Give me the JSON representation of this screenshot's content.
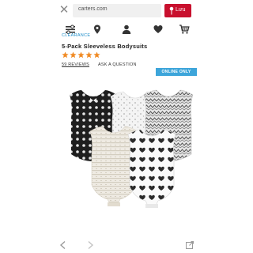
{
  "browser": {
    "url": "carters.com",
    "luu_label": "Lưu",
    "icons": {
      "close": "close-icon",
      "pin": "pin-icon",
      "back": "back-icon",
      "forward": "forward-icon",
      "share": "share-icon"
    }
  },
  "nav": {
    "icons": [
      "menu-filter-icon",
      "location-icon",
      "account-icon",
      "heart-icon",
      "cart-icon"
    ]
  },
  "product": {
    "category": "CLEARANCE",
    "title": "5-Pack Sleeveless Bodysuits",
    "rating": 5,
    "rating_max": 5,
    "reviews": "59 REVIEWS",
    "write_review": "ASK A QUESTION",
    "badge": "ONLINE ONLY"
  },
  "colors": {
    "accent_red": "#c8102e",
    "link_blue": "#1f8ec9",
    "badge_blue": "#3da5da",
    "star_orange": "#f08a24"
  }
}
